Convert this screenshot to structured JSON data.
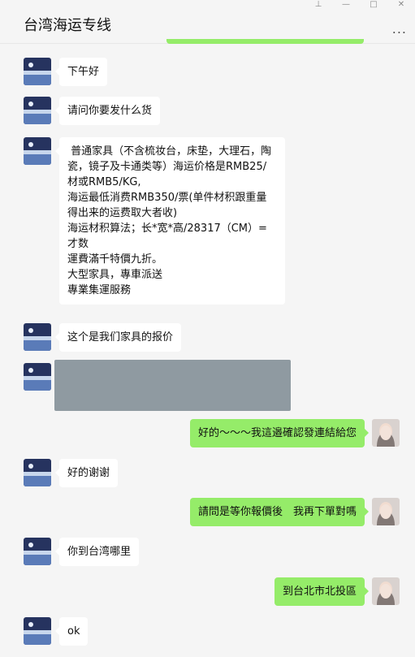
{
  "window": {
    "title": "台湾海运专线",
    "more_label": "...",
    "controls": {
      "pin": "⊥",
      "minimize": "—",
      "maximize": "□",
      "close": "✕"
    }
  },
  "colors": {
    "incoming_bubble": "#ffffff",
    "outgoing_bubble": "#95ec69",
    "background": "#f5f5f5"
  },
  "messages": [
    {
      "side": "in",
      "text": "下午好"
    },
    {
      "side": "in",
      "text": "请问你要发什么货"
    },
    {
      "side": "in",
      "text": " 普通家具（不含梳妆台，床垫，大理石，陶瓷，镜子及卡通类等）海运价格是RMB25/材或RMB5/KG,\n海运最低消费RMB350/票(单件材积跟重量得出来的运费取大者收)\n海运材积算法；长*宽*高/28317（CM）=才数\n運費滿千特價九折。\n大型家具，專車派送\n專業集運服務"
    },
    {
      "side": "in",
      "text": "这个是我们家具的报价"
    },
    {
      "side": "in",
      "type": "image"
    },
    {
      "side": "out",
      "text": "好的～～～我這邉確認發連結給您"
    },
    {
      "side": "in",
      "text": "好的谢谢"
    },
    {
      "side": "out",
      "text": "請問是等你報價後　我再下單對嗎"
    },
    {
      "side": "in",
      "text": "你到台湾哪里"
    },
    {
      "side": "out",
      "text": "到台北市北投區"
    },
    {
      "side": "in",
      "text": "ok"
    }
  ]
}
